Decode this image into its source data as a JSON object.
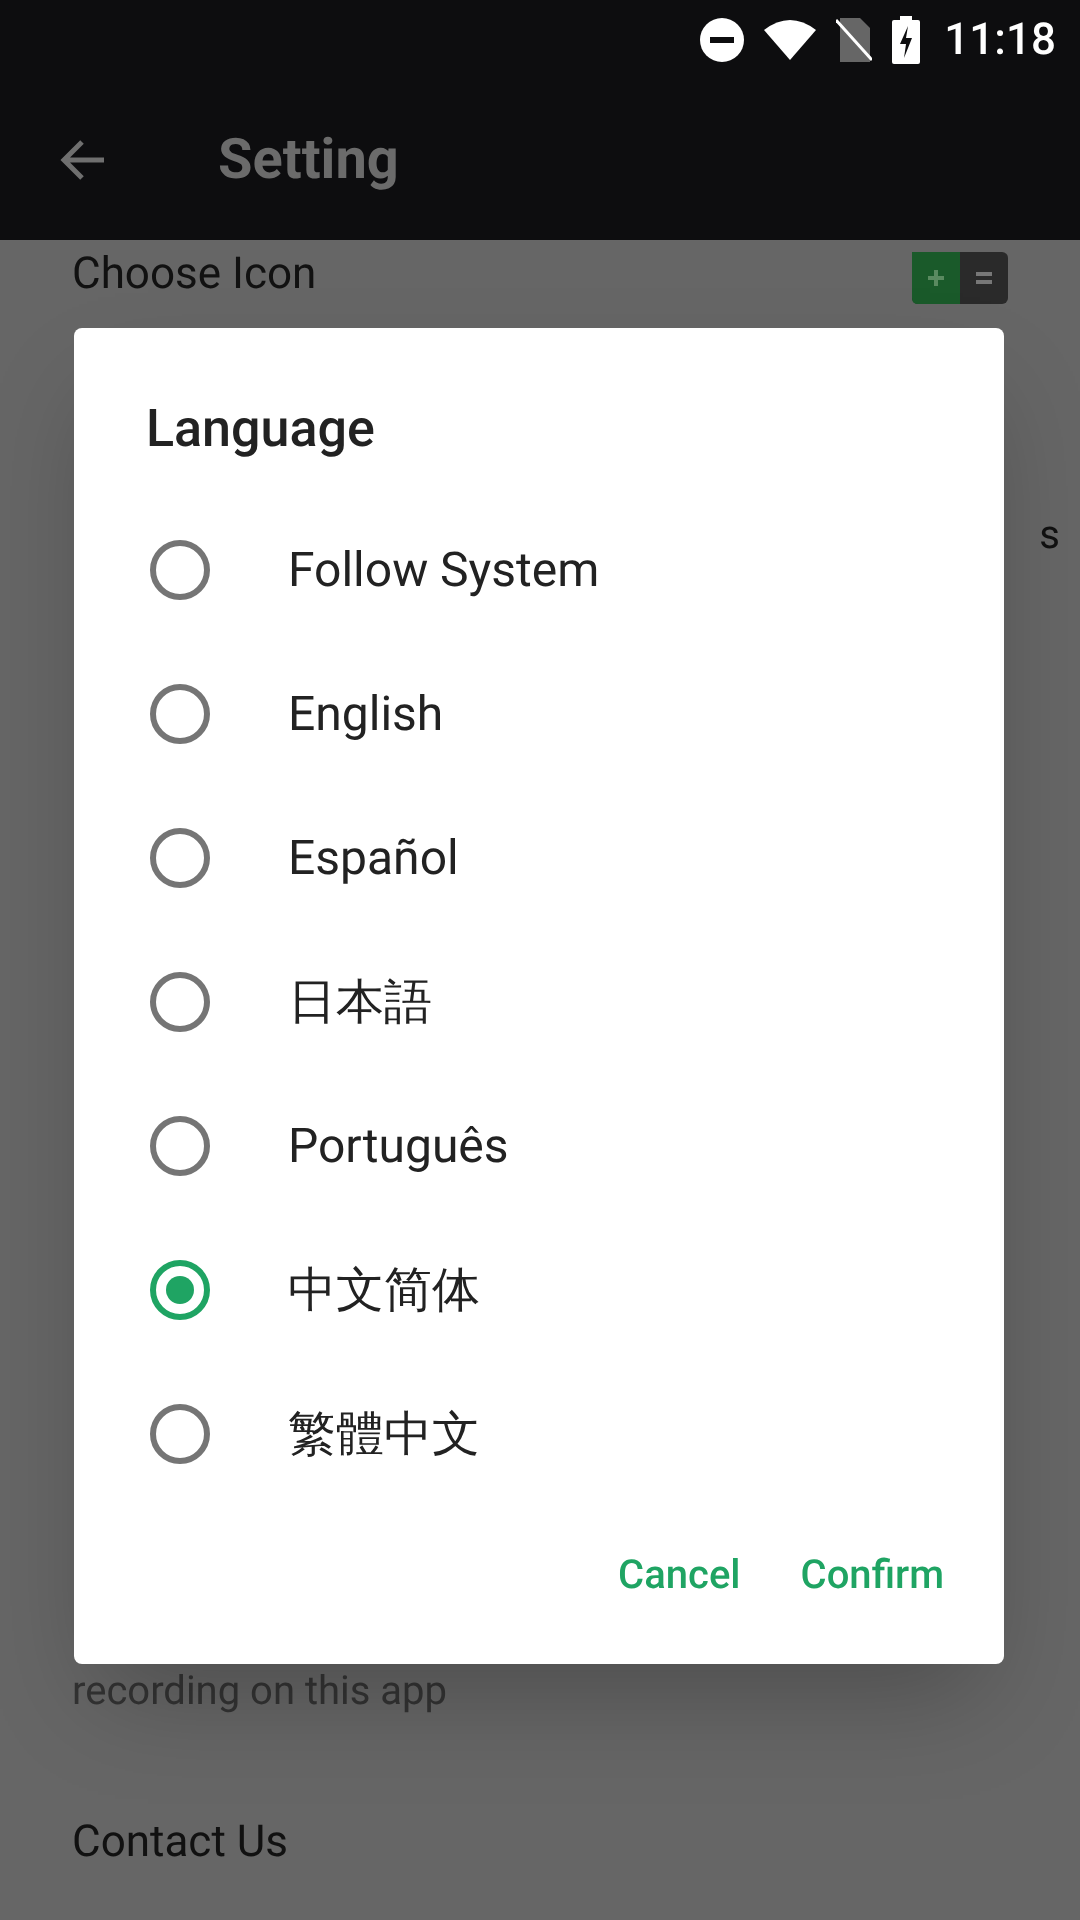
{
  "status_bar": {
    "time": "11:18"
  },
  "toolbar": {
    "title": "Setting"
  },
  "background_list": [
    {
      "kind": "title",
      "text": "Choose Icon"
    },
    {
      "kind": "fragment",
      "text": "s"
    },
    {
      "kind": "subtitle",
      "text": "recording on this app"
    },
    {
      "kind": "title",
      "text": "Contact Us"
    }
  ],
  "dialog": {
    "title": "Language",
    "options": [
      {
        "label": "Follow System",
        "selected": false
      },
      {
        "label": "English",
        "selected": false
      },
      {
        "label": "Español",
        "selected": false
      },
      {
        "label": "日本語",
        "selected": false
      },
      {
        "label": "Português",
        "selected": false
      },
      {
        "label": "中文简体",
        "selected": true
      },
      {
        "label": "繁體中文",
        "selected": false
      }
    ],
    "buttons": [
      "Cancel",
      "Confirm"
    ]
  }
}
